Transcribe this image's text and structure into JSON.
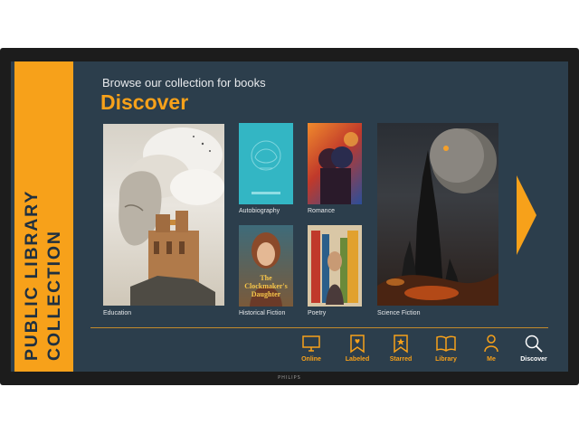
{
  "sidebar": {
    "title": "PUBLIC LIBRARY\nCOLLECTION"
  },
  "header": {
    "subtitle": "Browse our collection for books",
    "title": "Discover"
  },
  "books": [
    {
      "category": "Education"
    },
    {
      "category": "Autobiography"
    },
    {
      "category": "Romance"
    },
    {
      "category": "Historical Fiction",
      "cover_text": "The Clockmaker's Daughter"
    },
    {
      "category": "Poetry"
    },
    {
      "category": "Science Fiction"
    }
  ],
  "nav": [
    {
      "label": "Online",
      "icon": "monitor-icon"
    },
    {
      "label": "Labeled",
      "icon": "heart-bookmark-icon"
    },
    {
      "label": "Starred",
      "icon": "star-bookmark-icon"
    },
    {
      "label": "Library",
      "icon": "open-book-icon"
    },
    {
      "label": "Me",
      "icon": "person-icon"
    },
    {
      "label": "Discover",
      "icon": "search-icon",
      "active": true
    }
  ],
  "brand": "PHILIPS",
  "colors": {
    "accent": "#f7a11a",
    "screen_bg": "#2c3e4c",
    "active_nav": "#ffffff"
  }
}
